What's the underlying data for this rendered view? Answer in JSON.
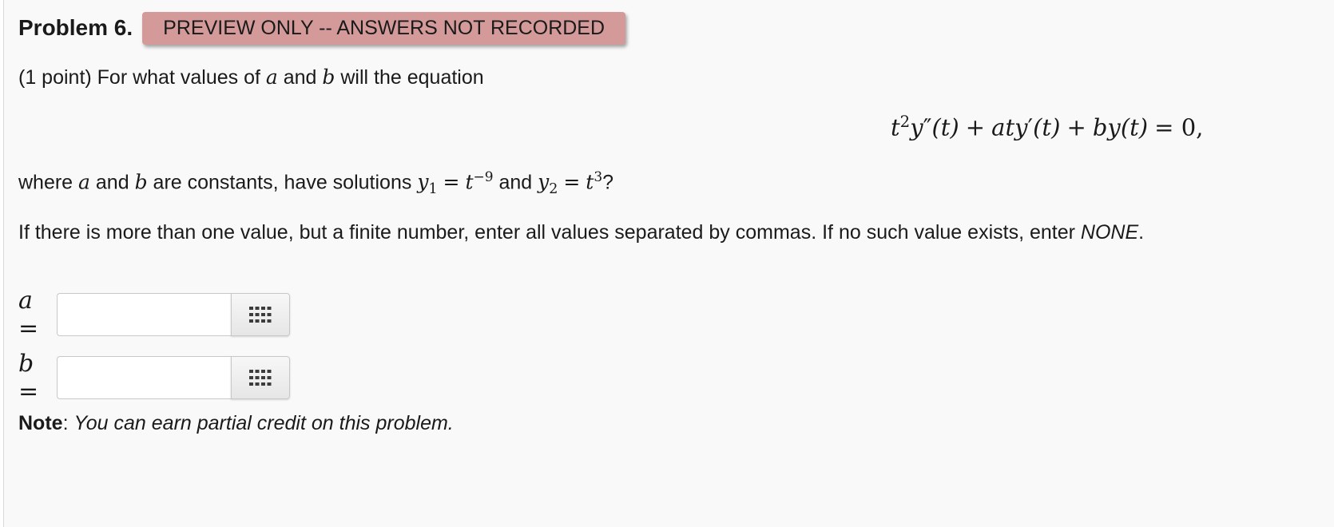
{
  "header": {
    "title": "Problem 6.",
    "badge": "PREVIEW ONLY -- ANSWERS NOT RECORDED"
  },
  "question": {
    "intro_prefix": "(1 point) For what values of",
    "var_a": "a",
    "and": "and",
    "var_b": "b",
    "intro_suffix": "will the equation",
    "equation": {
      "t": "t",
      "exp2": "2",
      "y": "y",
      "dbl_prime": "″",
      "prime": "′",
      "paren_t": "(t)",
      "plus": "+",
      "equals_zero": "= 0,"
    },
    "where_prefix": "where",
    "where_mid": "are constants, have solutions",
    "y1": "y",
    "sub1": "1",
    "eq": "=",
    "exp_neg9": "−9",
    "y2": "y",
    "sub2": "2",
    "exp3": "3",
    "qmark": "?",
    "instructions_main": "If there is more than one value, but a finite number, enter all values separated by commas. If no such value exists, enter",
    "none_word": "NONE",
    "period": "."
  },
  "answers": [
    {
      "label": "a",
      "equals": "=",
      "value": ""
    },
    {
      "label": "b",
      "equals": "=",
      "value": ""
    }
  ],
  "note": {
    "label": "Note",
    "colon": ":",
    "text": "You can earn partial credit on this problem."
  },
  "icons": {
    "answer_button": "keypad-grid-icon"
  }
}
